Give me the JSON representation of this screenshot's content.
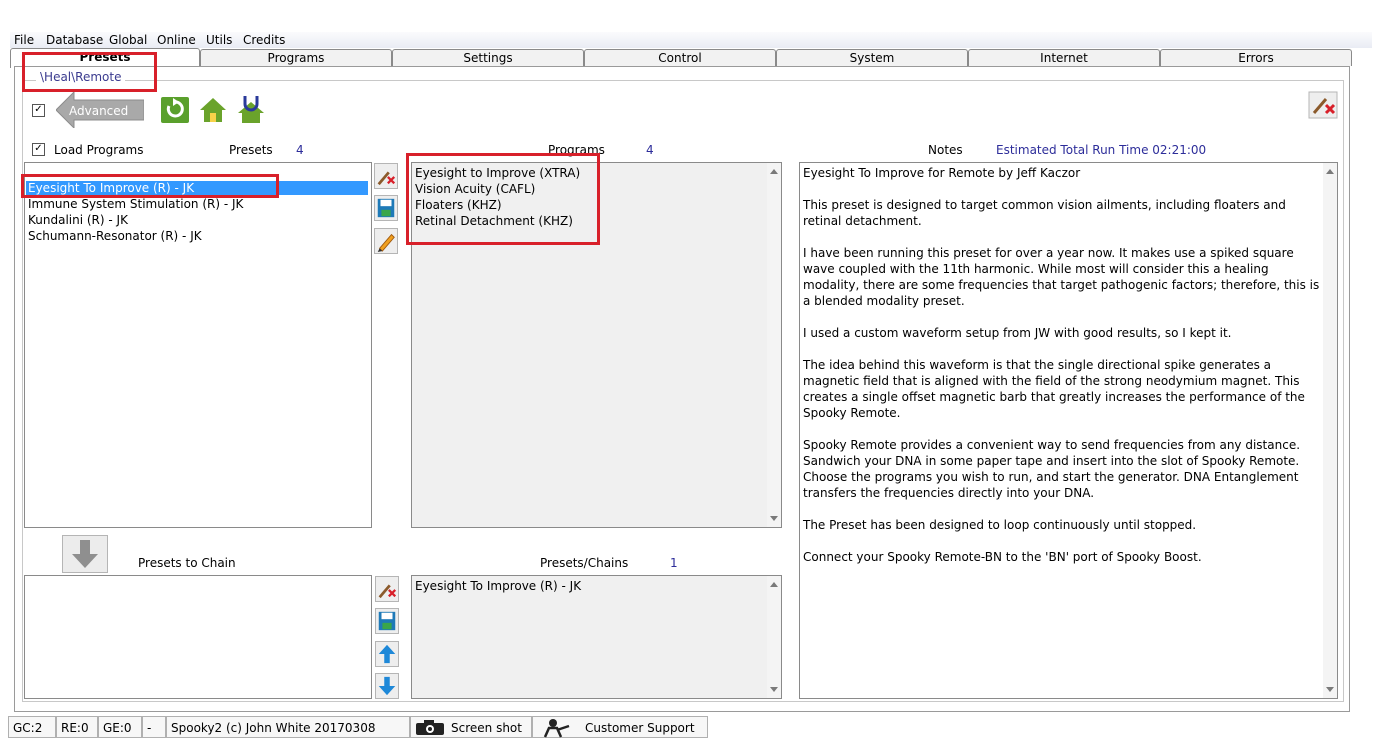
{
  "menu": [
    "File",
    "Database",
    "Global",
    "Online",
    "Utils",
    "Credits"
  ],
  "tabs": [
    "Presets",
    "Programs",
    "Settings",
    "Control",
    "System",
    "Internet",
    "Errors"
  ],
  "active_tab": "Presets",
  "path": "\\Heal\\Remote",
  "toolbar": {
    "advanced_label": "Advanced"
  },
  "presets_section": {
    "load_programs_label": "Load Programs",
    "presets_label": "Presets",
    "presets_count": "4",
    "items": [
      "Eyesight To Improve (R) - JK",
      "Immune System Stimulation (R) - JK",
      "Kundalini (R) - JK",
      "Schumann-Resonator (R) - JK"
    ],
    "selected_index": 0
  },
  "programs_section": {
    "label": "Programs",
    "count": "4",
    "items": [
      "Eyesight to Improve (XTRA)",
      "Vision Acuity (CAFL)",
      "Floaters (KHZ)",
      "Retinal Detachment (KHZ)"
    ]
  },
  "notes_section": {
    "label": "Notes",
    "run_time": "Estimated Total Run Time 02:21:00",
    "paragraphs": [
      "Eyesight To Improve for Remote by Jeff Kaczor",
      "This preset is designed to target common vision ailments, including floaters and retinal detachment.",
      "I have been running this preset for over a year now.  It makes use a spiked square wave coupled with the 11th harmonic.  While most will consider this a healing modality, there are some frequencies that target pathogenic factors; therefore, this is a blended modality preset.",
      "I used a custom waveform setup from JW with good results, so I kept it.",
      "The idea behind this waveform is that the single directional spike generates a magnetic field that is aligned with the field of the strong neodymium magnet.  This creates a single offset magnetic barb that greatly increases the performance of the Spooky Remote.",
      "Spooky Remote provides a convenient way to send frequencies from any distance. Sandwich your DNA in some paper tape and insert into the slot of Spooky Remote. Choose the programs you wish to run, and start the generator. DNA Entanglement transfers the frequencies directly into your DNA.",
      "The Preset has been designed to loop continuously until stopped.",
      "Connect your Spooky Remote-BN to the 'BN' port of Spooky Boost."
    ]
  },
  "chain_section": {
    "presets_to_chain_label": "Presets to Chain",
    "presets_chains_label": "Presets/Chains",
    "presets_chains_count": "1",
    "chains": [
      "Eyesight To Improve (R) - JK"
    ]
  },
  "status": {
    "gc": "GC:2",
    "re": "RE:0",
    "ge": "GE:0",
    "dash": "-",
    "copyright": "Spooky2 (c) John White 20170308",
    "screenshot": "Screen shot",
    "support": "Customer Support"
  },
  "colors": {
    "selection": "#3399ff",
    "highlight_box": "#d8202a",
    "count_text": "#2d2d9a",
    "home_green": "#6aa32b"
  }
}
